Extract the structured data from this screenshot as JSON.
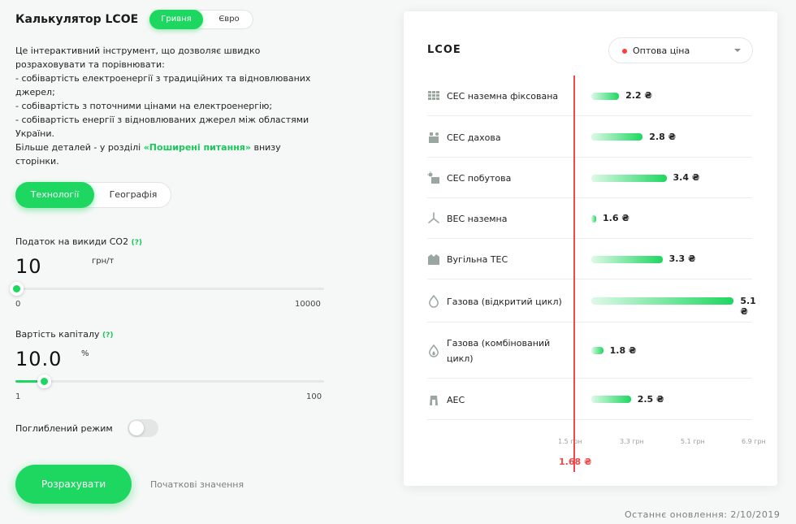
{
  "header": {
    "title": "Калькулятор LCOE",
    "currency_options": [
      "Гривня",
      "Євро"
    ]
  },
  "description": {
    "lines": [
      "Це інтерактивний інструмент, що дозволяє швидко",
      "розраховувати та порівнювати:",
      "- собівартість електроенергії з традиційних та відновлюваних",
      "джерел;",
      "- собівартість з поточними цінами на електроенергію;",
      "- собівартість енергії з відновлюваних джерел між областями",
      "України."
    ],
    "more_prefix": "Більше деталей - у розділі ",
    "more_link": "«Поширені питання»",
    "more_suffix": " внизу",
    "more_last": "сторінки."
  },
  "tabs": [
    "Технології",
    "Географія"
  ],
  "co2_tax": {
    "label": "Податок на викиди СО2",
    "help": "(?)",
    "value": "10",
    "unit": "грн/т",
    "min": "0",
    "max": "10000",
    "slider_fraction": 0.001
  },
  "capital_cost": {
    "label": "Вартість капіталу",
    "help": "(?)",
    "value": "10.0",
    "unit": "%",
    "min": "1",
    "max": "100",
    "slider_fraction": 0.091
  },
  "deep_mode": {
    "label": "Поглиблений режим",
    "enabled": false
  },
  "actions": {
    "calculate": "Розрахувати",
    "reset": "Початкові значення"
  },
  "chart_card": {
    "title": "LCOE",
    "dropdown": {
      "selected": "Оптова ціна"
    },
    "reference": {
      "label": "1.68 ₴",
      "value": 1.68
    },
    "axis_ticks": [
      "1.5 грн",
      "3.3 грн",
      "5.1 грн",
      "6.9 грн"
    ]
  },
  "chart_data": {
    "type": "bar",
    "orientation": "horizontal",
    "categories": [
      "СЕС наземна фіксована",
      "СЕС дахова",
      "СЕС побутова",
      "ВЕС наземна",
      "Вугільна ТЕС",
      "Газова (відкритий цикл)",
      "Газова (комбінований цикл)",
      "АЕС"
    ],
    "category_icons": [
      "solar-panel-icon",
      "solar-roof-icon",
      "solar-home-icon",
      "wind-turbine-icon",
      "coal-plant-icon",
      "gas-flame-icon",
      "gas-flame-combined-icon",
      "nuclear-plant-icon"
    ],
    "values": [
      2.2,
      2.8,
      3.4,
      1.6,
      3.3,
      5.1,
      1.8,
      2.5
    ],
    "value_labels": [
      "2.2 ₴",
      "2.8 ₴",
      "3.4 ₴",
      "1.6 ₴",
      "3.3 ₴",
      "5.1 ₴",
      "1.8 ₴",
      "2.5 ₴"
    ],
    "reference_line": 1.68,
    "xlim": [
      1.5,
      6.9
    ],
    "bar_color": "#1ed760",
    "reference_color": "#f04848"
  },
  "footer": {
    "updated_label": "Останнє оновлення:",
    "updated_date": "2/10/2019"
  }
}
